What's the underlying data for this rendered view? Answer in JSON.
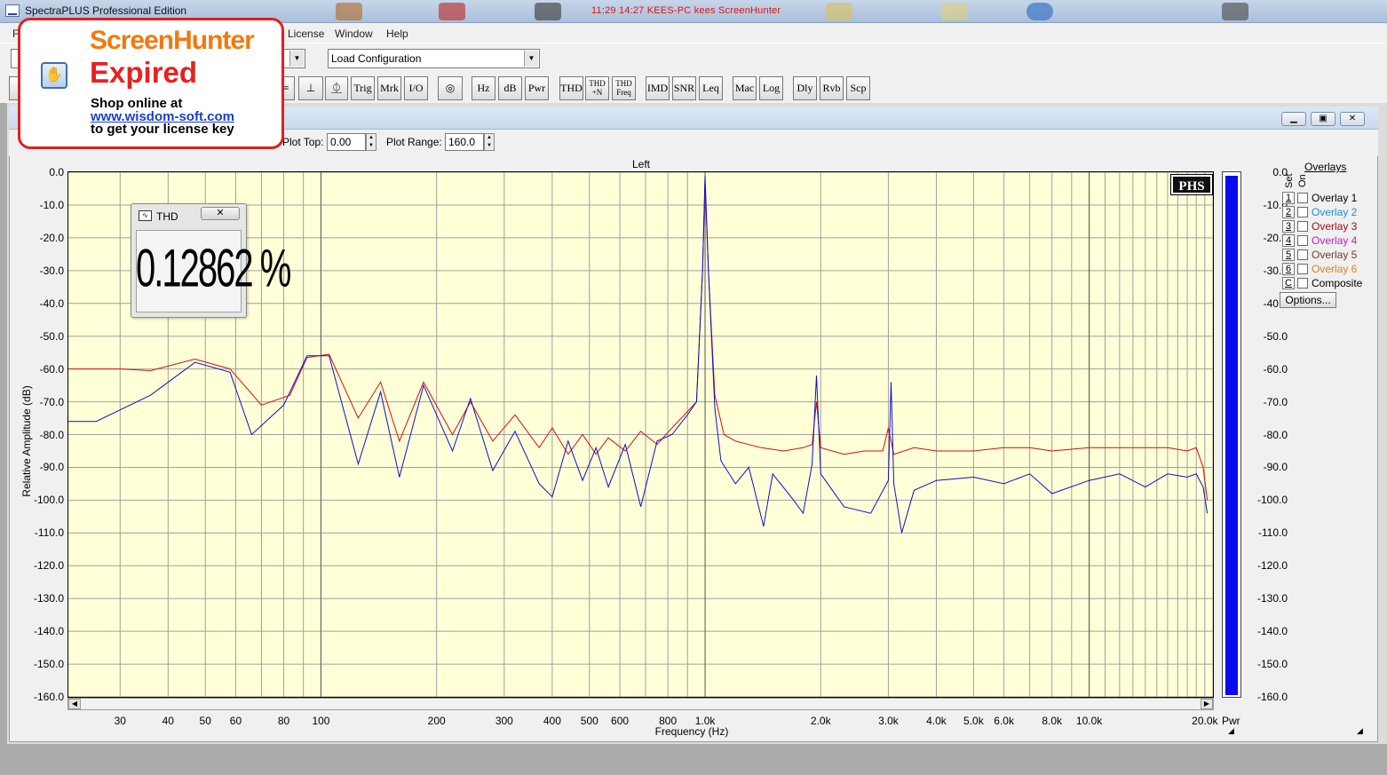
{
  "window": {
    "title": "SpectraPLUS Professional Edition",
    "overlay_text": "11:29  14:27  KEES-PC  kees  ScreenHunter",
    "colors": {
      "titlebar": "#b9cbe2",
      "overlay_text": "#e01010"
    }
  },
  "menu": {
    "items": [
      {
        "label": "F"
      },
      {
        "label": "License"
      },
      {
        "label": "Window"
      },
      {
        "label": "Help"
      }
    ]
  },
  "toolbar1": {
    "left_combo_value": "n",
    "config_combo_value": "Load Configuration"
  },
  "toolbar2": {
    "buttons": [
      {
        "label": "Trig"
      },
      {
        "label": "Mrk"
      },
      {
        "label": "I/O"
      },
      {
        "label": "Hz"
      },
      {
        "label": "dB"
      },
      {
        "label": "Pwr"
      },
      {
        "label": "THD"
      },
      {
        "label": "THD +N"
      },
      {
        "label": "THD Freq"
      },
      {
        "label": "IMD"
      },
      {
        "label": "SNR"
      },
      {
        "label": "Leq"
      },
      {
        "label": "Mac"
      },
      {
        "label": "Log"
      },
      {
        "label": "Dly"
      },
      {
        "label": "Rvb"
      },
      {
        "label": "Scp"
      }
    ]
  },
  "plot_controls": {
    "plot_top_label": "Plot Top:",
    "plot_top_value": "0.00",
    "plot_range_label": "Plot Range:",
    "plot_range_value": "160.0"
  },
  "thd_window": {
    "title": "THD",
    "close_symbol": "✕",
    "value": "0.12862 %"
  },
  "screenhunter_ad": {
    "logo_part1": "Screen",
    "logo_part2": "Hunter",
    "expired": "Expired",
    "line1": "Shop online at",
    "link": "www.wisdom-soft.com",
    "line3": "to get your license key"
  },
  "badge": "PHS",
  "power_meter": {
    "label": "Pwr",
    "level_fraction": 0.99,
    "color": "#0a0aef"
  },
  "overlays": {
    "title": "Overlays",
    "set_label": "Set",
    "on_label": "On",
    "items": [
      {
        "key": "1",
        "name": "Overlay 1",
        "color": "#000000",
        "checked": false
      },
      {
        "key": "2",
        "name": "Overlay 2",
        "color": "#1e8fd0",
        "checked": false
      },
      {
        "key": "3",
        "name": "Overlay 3",
        "color": "#a01010",
        "checked": false
      },
      {
        "key": "4",
        "name": "Overlay 4",
        "color": "#c020c0",
        "checked": false
      },
      {
        "key": "5",
        "name": "Overlay 5",
        "color": "#704020",
        "checked": false
      },
      {
        "key": "6",
        "name": "Overlay 6",
        "color": "#e08020",
        "checked": false
      },
      {
        "key": "C",
        "name": "Composite",
        "color": "#000000",
        "checked": false
      }
    ],
    "options_label": "Options..."
  },
  "chart_data": {
    "type": "line",
    "title": "Left",
    "xlabel": "Frequency (Hz)",
    "ylabel": "Relative Amplitude (dB)",
    "x_scale": "log",
    "xlim": [
      22,
      21000
    ],
    "ylim": [
      -160,
      0
    ],
    "y_ticks": [
      "0.0",
      "-10.0",
      "-20.0",
      "-30.0",
      "-40.0",
      "-50.0",
      "-60.0",
      "-70.0",
      "-80.0",
      "-90.0",
      "-100.0",
      "-110.0",
      "-120.0",
      "-130.0",
      "-140.0",
      "-150.0",
      "-160.0"
    ],
    "x_tick_labels": [
      {
        "f": 30,
        "label": "30"
      },
      {
        "f": 40,
        "label": "40"
      },
      {
        "f": 50,
        "label": "50"
      },
      {
        "f": 60,
        "label": "60"
      },
      {
        "f": 80,
        "label": "80"
      },
      {
        "f": 100,
        "label": "100"
      },
      {
        "f": 200,
        "label": "200"
      },
      {
        "f": 300,
        "label": "300"
      },
      {
        "f": 400,
        "label": "400"
      },
      {
        "f": 500,
        "label": "500"
      },
      {
        "f": 600,
        "label": "600"
      },
      {
        "f": 800,
        "label": "800"
      },
      {
        "f": 1000,
        "label": "1.0k"
      },
      {
        "f": 2000,
        "label": "2.0k"
      },
      {
        "f": 3000,
        "label": "3.0k"
      },
      {
        "f": 4000,
        "label": "4.0k"
      },
      {
        "f": 5000,
        "label": "5.0k"
      },
      {
        "f": 6000,
        "label": "6.0k"
      },
      {
        "f": 8000,
        "label": "8.0k"
      },
      {
        "f": 10000,
        "label": "10.0k"
      },
      {
        "f": 20000,
        "label": "20.0k"
      }
    ],
    "right_ticks": [
      "0.0",
      "-10.0",
      "-20.0",
      "-30.0",
      "-40.0",
      "-50.0",
      "-60.0",
      "-70.0",
      "-80.0",
      "-90.0",
      "-100.0",
      "-110.0",
      "-120.0",
      "-130.0",
      "-140.0",
      "-150.0",
      "-160.0"
    ],
    "grid": true,
    "background": "#ffffd8",
    "series": [
      {
        "color": "#d01010",
        "points": [
          [
            22,
            -60
          ],
          [
            30,
            -60
          ],
          [
            36,
            -60.5
          ],
          [
            47,
            -57
          ],
          [
            58,
            -60
          ],
          [
            70,
            -71
          ],
          [
            83,
            -68
          ],
          [
            92,
            -56.5
          ],
          [
            105,
            -55.5
          ],
          [
            125,
            -75
          ],
          [
            143,
            -64
          ],
          [
            160,
            -82
          ],
          [
            185,
            -64
          ],
          [
            220,
            -80
          ],
          [
            245,
            -70
          ],
          [
            280,
            -82
          ],
          [
            320,
            -74
          ],
          [
            370,
            -84
          ],
          [
            400,
            -78
          ],
          [
            440,
            -86
          ],
          [
            480,
            -80
          ],
          [
            520,
            -86
          ],
          [
            560,
            -81
          ],
          [
            620,
            -85
          ],
          [
            680,
            -79
          ],
          [
            750,
            -83
          ],
          [
            820,
            -78
          ],
          [
            900,
            -73
          ],
          [
            950,
            -70
          ],
          [
            985,
            -30
          ],
          [
            1000,
            -3
          ],
          [
            1020,
            -30
          ],
          [
            1060,
            -68
          ],
          [
            1120,
            -80
          ],
          [
            1200,
            -82
          ],
          [
            1400,
            -84
          ],
          [
            1600,
            -85
          ],
          [
            1800,
            -84
          ],
          [
            1900,
            -83
          ],
          [
            1950,
            -70
          ],
          [
            2000,
            -84
          ],
          [
            2300,
            -86
          ],
          [
            2600,
            -85
          ],
          [
            2900,
            -85
          ],
          [
            3000,
            -78
          ],
          [
            3100,
            -86
          ],
          [
            3500,
            -84
          ],
          [
            4000,
            -85
          ],
          [
            5000,
            -85
          ],
          [
            6000,
            -84
          ],
          [
            7000,
            -84
          ],
          [
            8000,
            -85
          ],
          [
            10000,
            -84
          ],
          [
            12000,
            -84
          ],
          [
            14000,
            -84
          ],
          [
            16000,
            -84
          ],
          [
            18000,
            -85
          ],
          [
            19000,
            -84
          ],
          [
            19800,
            -90
          ],
          [
            20300,
            -100
          ]
        ]
      },
      {
        "color": "#1010c8",
        "points": [
          [
            22,
            -76
          ],
          [
            26,
            -76
          ],
          [
            36,
            -68
          ],
          [
            47,
            -58
          ],
          [
            58,
            -61
          ],
          [
            66,
            -80
          ],
          [
            80,
            -71
          ],
          [
            92,
            -56
          ],
          [
            105,
            -56
          ],
          [
            125,
            -89
          ],
          [
            143,
            -67
          ],
          [
            160,
            -93
          ],
          [
            185,
            -65
          ],
          [
            220,
            -85
          ],
          [
            245,
            -69
          ],
          [
            280,
            -91
          ],
          [
            320,
            -79
          ],
          [
            370,
            -95
          ],
          [
            400,
            -99
          ],
          [
            440,
            -82
          ],
          [
            480,
            -94
          ],
          [
            520,
            -84
          ],
          [
            560,
            -96
          ],
          [
            620,
            -83
          ],
          [
            680,
            -102
          ],
          [
            750,
            -82
          ],
          [
            820,
            -80
          ],
          [
            900,
            -74
          ],
          [
            950,
            -70
          ],
          [
            985,
            -30
          ],
          [
            1000,
            -1
          ],
          [
            1020,
            -30
          ],
          [
            1060,
            -72
          ],
          [
            1100,
            -88
          ],
          [
            1200,
            -95
          ],
          [
            1300,
            -90
          ],
          [
            1420,
            -108
          ],
          [
            1500,
            -92
          ],
          [
            1700,
            -100
          ],
          [
            1800,
            -104
          ],
          [
            1900,
            -89
          ],
          [
            1950,
            -62
          ],
          [
            2000,
            -92
          ],
          [
            2300,
            -102
          ],
          [
            2700,
            -104
          ],
          [
            3000,
            -94
          ],
          [
            3050,
            -64
          ],
          [
            3100,
            -95
          ],
          [
            3250,
            -110
          ],
          [
            3500,
            -97
          ],
          [
            4000,
            -94
          ],
          [
            5000,
            -93
          ],
          [
            6000,
            -95
          ],
          [
            7000,
            -92
          ],
          [
            8000,
            -98
          ],
          [
            10000,
            -94
          ],
          [
            12000,
            -92
          ],
          [
            14000,
            -96
          ],
          [
            16000,
            -92
          ],
          [
            18000,
            -93
          ],
          [
            19000,
            -92
          ],
          [
            19800,
            -96
          ],
          [
            20300,
            -104
          ]
        ]
      }
    ]
  }
}
